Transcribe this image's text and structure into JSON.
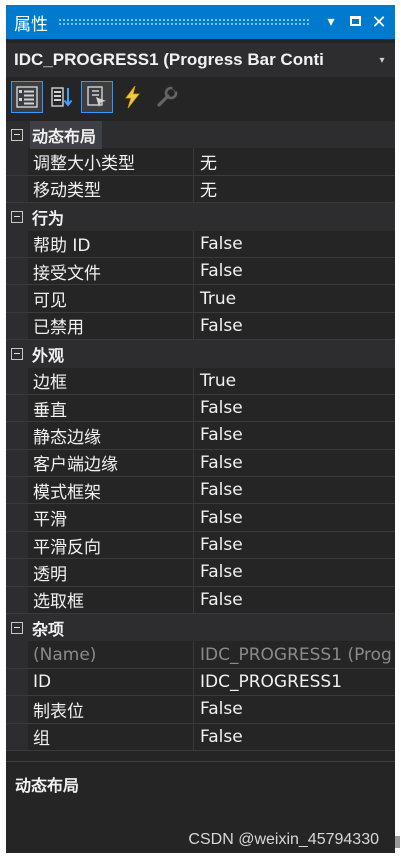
{
  "window": {
    "title": "属性",
    "dropdown_glyph": "▾",
    "close_glyph": "✕"
  },
  "object_selector": {
    "value": "IDC_PROGRESS1 (Progress Bar Conti",
    "arrow": "▾"
  },
  "toolbar": {
    "buttons": [
      {
        "name": "categorized-icon",
        "active": true
      },
      {
        "name": "alphabetical-icon",
        "active": false
      },
      {
        "name": "properties-icon",
        "active": true
      },
      {
        "name": "events-icon",
        "active": false
      },
      {
        "name": "property-pages-icon",
        "active": false,
        "disabled": true
      }
    ]
  },
  "categories": [
    {
      "name": "动态布局",
      "selected": true,
      "properties": [
        {
          "name": "调整大小类型",
          "value": "无"
        },
        {
          "name": "移动类型",
          "value": "无"
        }
      ]
    },
    {
      "name": "行为",
      "properties": [
        {
          "name": "帮助 ID",
          "value": "False"
        },
        {
          "name": "接受文件",
          "value": "False"
        },
        {
          "name": "可见",
          "value": "True"
        },
        {
          "name": "已禁用",
          "value": "False"
        }
      ]
    },
    {
      "name": "外观",
      "properties": [
        {
          "name": "边框",
          "value": "True"
        },
        {
          "name": "垂直",
          "value": "False"
        },
        {
          "name": "静态边缘",
          "value": "False"
        },
        {
          "name": "客户端边缘",
          "value": "False"
        },
        {
          "name": "模式框架",
          "value": "False"
        },
        {
          "name": "平滑",
          "value": "False"
        },
        {
          "name": "平滑反向",
          "value": "False"
        },
        {
          "name": "透明",
          "value": "False"
        },
        {
          "name": "选取框",
          "value": "False"
        }
      ]
    },
    {
      "name": "杂项",
      "properties": [
        {
          "name": "(Name)",
          "value": "IDC_PROGRESS1 (Prog",
          "dim": true
        },
        {
          "name": "ID",
          "value": "IDC_PROGRESS1"
        },
        {
          "name": "制表位",
          "value": "False"
        },
        {
          "name": "组",
          "value": "False"
        }
      ]
    }
  ],
  "description": {
    "title": "动态布局"
  },
  "watermark": "CSDN @weixin_45794330",
  "colors": {
    "accent": "#007acc",
    "panel_bg": "#252526",
    "gutter_bg": "#2d2d30",
    "text": "#f1f1f1",
    "dim_text": "#8a8a8a"
  }
}
